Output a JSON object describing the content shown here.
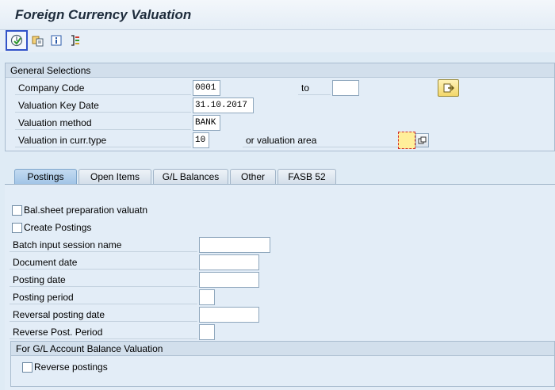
{
  "window": {
    "title": "Foreign Currency Valuation"
  },
  "toolbar": {
    "buttons": [
      {
        "name": "execute-icon"
      },
      {
        "name": "get-variant-icon"
      },
      {
        "name": "info-icon"
      },
      {
        "name": "selection-options-icon"
      }
    ]
  },
  "general": {
    "header": "General Selections",
    "company_code": {
      "label": "Company Code",
      "value": "0001",
      "to_label": "to",
      "to_value": ""
    },
    "key_date": {
      "label": "Valuation Key Date",
      "value": "31.10.2017"
    },
    "method": {
      "label": "Valuation method",
      "value": "BANK"
    },
    "curr_type": {
      "label": "Valuation in curr.type",
      "value": "10",
      "area_label": "or valuation area",
      "area_value": ""
    }
  },
  "tabs": [
    {
      "label": "Postings"
    },
    {
      "label": "Open Items"
    },
    {
      "label": "G/L Balances"
    },
    {
      "label": "Other"
    },
    {
      "label": "FASB 52"
    }
  ],
  "postings": {
    "bal_sheet": {
      "label": "Bal.sheet preparation valuatn",
      "checked": false
    },
    "create": {
      "label": "Create Postings",
      "checked": false
    },
    "batch_session": {
      "label": "Batch input session name",
      "value": ""
    },
    "doc_date": {
      "label": "Document date",
      "value": ""
    },
    "posting_date": {
      "label": "Posting date",
      "value": ""
    },
    "posting_period": {
      "label": "Posting period",
      "value": ""
    },
    "reversal_date": {
      "label": "Reversal posting date",
      "value": ""
    },
    "reverse_period": {
      "label": "Reverse Post. Period",
      "value": ""
    },
    "gl_section": {
      "header": "For G/L Account Balance Valuation",
      "reverse": {
        "label": "Reverse postings",
        "checked": false
      }
    }
  },
  "colors": {
    "accent": "#3253c8",
    "background": "#dfebf5",
    "selected_tab": "#9fc3e6"
  }
}
